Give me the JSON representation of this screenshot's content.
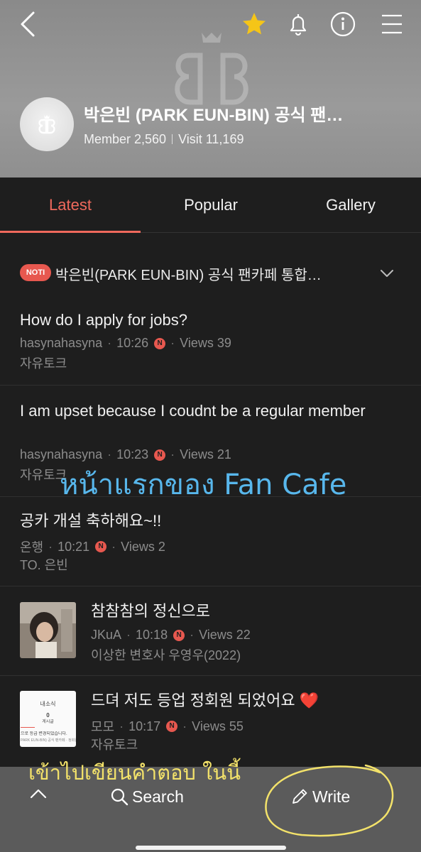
{
  "header": {
    "cafe_title": "박은빈 (PARK EUN-BIN) 공식 팬…",
    "member_label": "Member 2,560",
    "visit_label": "Visit 11,169",
    "icons": [
      "back-icon",
      "star-icon",
      "bell-icon",
      "info-icon",
      "menu-icon"
    ],
    "star_color": "#f5c518"
  },
  "tabs": [
    {
      "label": "Latest",
      "active": true
    },
    {
      "label": "Popular",
      "active": false
    },
    {
      "label": "Gallery",
      "active": false
    }
  ],
  "notice": {
    "badge": "NOTI",
    "text": "박은빈(PARK EUN-BIN) 공식 팬카페 통합…"
  },
  "posts": [
    {
      "title": "How do I apply for jobs?",
      "author": "hasynahasyna",
      "time": "10:26",
      "badge": "N",
      "views": "Views 39",
      "board": "자유토크"
    },
    {
      "title": "I am upset because I coudnt be a regular member",
      "author": "hasynahasyna",
      "time": "10:23",
      "badge": "N",
      "views": "Views 21",
      "board": "자유토크"
    },
    {
      "title": "공카 개설 축하해요~!!",
      "author": "온행",
      "time": "10:21",
      "badge": "N",
      "views": "Views 2",
      "board": "TO. 은빈"
    },
    {
      "title": "참참참의 정신으로",
      "author": "JKuA",
      "time": "10:18",
      "badge": "N",
      "views": "Views 22",
      "board": "이상한 변호사 우영우(2022)"
    },
    {
      "title": "드뎌 저도 등업 정회원 되었어요 ❤️",
      "author": "모모",
      "time": "10:17",
      "badge": "N",
      "views": "Views 55",
      "board": "자유토크",
      "thumb_text": {
        "t1": "내소식",
        "t2": "0",
        "t3": "게시글",
        "t4": "으로 등급 변경되었습니다.",
        "t5": "PARK EUN-BIN) 공식 팬카페 · 정회원"
      }
    }
  ],
  "overlay": {
    "main_caption": "หน้าแรกของ Fan Cafe",
    "bottom_caption": "เข้าไปเขียนคำตอบ ในนี้"
  },
  "bottombar": {
    "search_label": "Search",
    "write_label": "Write"
  },
  "colors": {
    "accent": "#f0695c",
    "overlay_blue": "#58b7ec",
    "annotation_yellow": "#f3e26a"
  }
}
